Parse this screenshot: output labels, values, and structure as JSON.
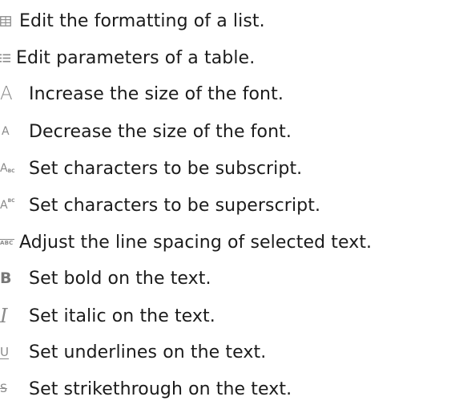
{
  "items": [
    {
      "icon": "table-grid-icon",
      "text": "Edit the formatting of a list."
    },
    {
      "icon": "list-lines-icon",
      "text": "Edit parameters of a table."
    },
    {
      "icon": "increase-font-icon",
      "glyph": "A",
      "text": "Increase the size of the font."
    },
    {
      "icon": "decrease-font-icon",
      "glyph": "A",
      "text": "Decrease the size of the font."
    },
    {
      "icon": "subscript-icon",
      "glyph": "A",
      "glyph_sub": "BC",
      "text": "Set characters to be subscript."
    },
    {
      "icon": "superscript-icon",
      "glyph": "A",
      "glyph_sup": "BC",
      "text": "Set characters to be superscript."
    },
    {
      "icon": "line-spacing-icon",
      "glyph": "ABC",
      "text": "Adjust the line spacing of selected text."
    },
    {
      "icon": "bold-icon",
      "glyph": "B",
      "text": "Set bold on the text."
    },
    {
      "icon": "italic-icon",
      "glyph": "I",
      "text": "Set italic on the text."
    },
    {
      "icon": "underline-icon",
      "glyph": "U",
      "text": "Set underlines on the text."
    },
    {
      "icon": "strikethrough-icon",
      "glyph": "S",
      "text": "Set strikethrough on the text."
    }
  ],
  "colors": {
    "text": "#1b1b1b",
    "icon": "#8a8a8a"
  }
}
